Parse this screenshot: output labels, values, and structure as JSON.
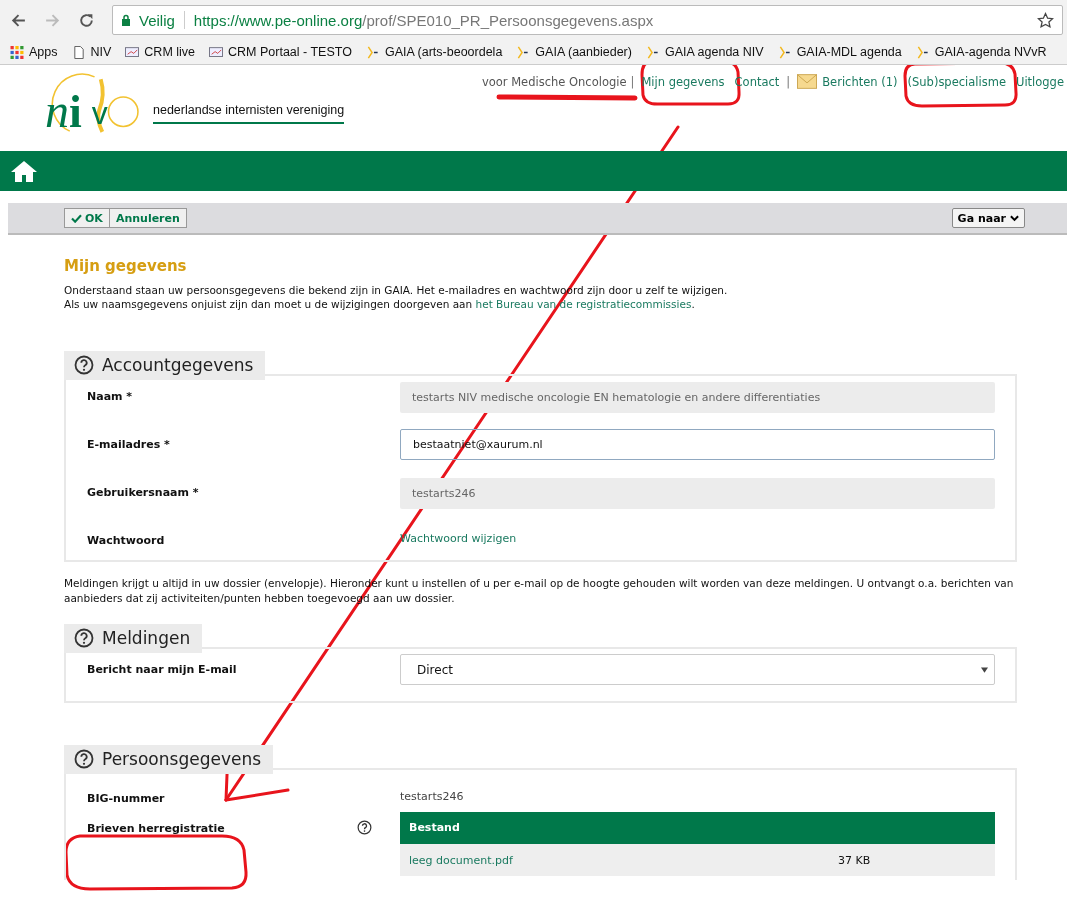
{
  "browser": {
    "security": "Veilig",
    "url_host": "https://www.pe-online.org",
    "url_path": "/prof/SPE010_PR_Persoonsgegevens.aspx",
    "bookmarks": [
      {
        "kind": "apps",
        "label": "Apps"
      },
      {
        "kind": "page",
        "label": "NIV"
      },
      {
        "kind": "crm",
        "label": "CRM live"
      },
      {
        "kind": "crm",
        "label": "CRM Portaal - TESTO"
      },
      {
        "kind": "gaia",
        "label": "GAIA (arts-beoordela"
      },
      {
        "kind": "gaia",
        "label": "GAIA (aanbieder)"
      },
      {
        "kind": "gaia",
        "label": "GAIA agenda NIV"
      },
      {
        "kind": "gaia",
        "label": "GAIA-MDL agenda"
      },
      {
        "kind": "gaia",
        "label": "GAIA-agenda NVvR"
      }
    ]
  },
  "header": {
    "logo_letters": [
      "n",
      "i",
      "v"
    ],
    "tagline": "nederlandse internisten vereniging",
    "links": [
      {
        "kind": "text",
        "label": "voor Medische Oncologie"
      },
      {
        "kind": "sep",
        "label": "|"
      },
      {
        "kind": "link",
        "label": "Mijn gegevens"
      },
      {
        "kind": "link",
        "label": "Contact"
      },
      {
        "kind": "sep",
        "label": "|"
      },
      {
        "kind": "mail",
        "label": "Berichten (1)"
      },
      {
        "kind": "link",
        "label": "(Sub)specialisme"
      },
      {
        "kind": "link",
        "label": "Uitlogge"
      }
    ]
  },
  "toolbar": {
    "ok": "OK",
    "cancel": "Annuleren",
    "goto": "Ga naar"
  },
  "page": {
    "title": "Mijn gegevens",
    "intro": [
      "Onderstaand staan uw persoonsgegevens die bekend zijn in GAIA. Het e-mailadres en wachtwoord zijn door u zelf te wijzigen."
    ],
    "intro2": "Als uw naamsgegevens onjuist zijn dan moet u de wijzigingen doorgeven aan",
    "intro2_link": "het Bureau van de registratiecommissies",
    "intro2_end": "."
  },
  "account": {
    "title": "Accountgegevens",
    "rows": [
      {
        "kind": "readonly",
        "label": "Naam *",
        "value": "testarts NIV medische oncologie EN hematologie en andere differentiaties"
      },
      {
        "kind": "input",
        "label": "E-mailadres *",
        "value": "bestaatniet@xaurum.nl"
      },
      {
        "kind": "readonly",
        "label": "Gebruikersnaam *",
        "value": "testarts246"
      },
      {
        "kind": "link",
        "label": "Wachtwoord",
        "value": "Wachtwoord wijzigen"
      }
    ]
  },
  "notifications_text": "Meldingen krijgt u altijd in uw dossier (envelopje). Hieronder kunt u instellen of u per e-mail op de hoogte gehouden wilt worden van deze meldingen. U ontvangt o.a. berichten van aanbieders dat zij activiteiten/punten hebben toegevoegd aan uw dossier.",
  "notifications": {
    "title": "Meldingen",
    "label": "Bericht naar mijn E-mail",
    "value": "Direct"
  },
  "personal": {
    "title": "Persoonsgegevens",
    "big_label": "BIG-nummer",
    "big_value": "testarts246",
    "letters_label": "Brieven herregistratie",
    "files_header": "Bestand",
    "files": [
      {
        "name": "leeg document.pdf",
        "size": "37 KB"
      }
    ]
  }
}
